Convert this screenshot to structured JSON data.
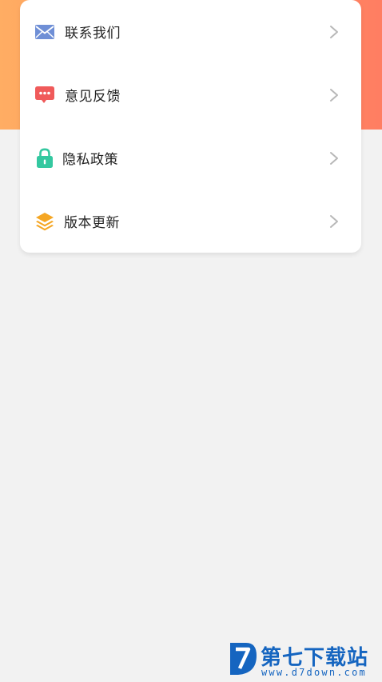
{
  "colors": {
    "header_gradient_start": "#ffad63",
    "header_gradient_end": "#ff7e62",
    "background": "#f2f2f2",
    "card": "#ffffff",
    "mail_icon": "#6f8fd6",
    "feedback_icon": "#f05a5a",
    "lock_icon": "#34c8a0",
    "layers_icon": "#f5a623",
    "chevron": "#b8b8b8",
    "watermark": "#1565c0"
  },
  "menu": {
    "items": [
      {
        "label": "联系我们",
        "icon": "mail-icon"
      },
      {
        "label": "意见反馈",
        "icon": "feedback-icon"
      },
      {
        "label": "隐私政策",
        "icon": "lock-icon"
      },
      {
        "label": "版本更新",
        "icon": "layers-icon"
      }
    ]
  },
  "watermark": {
    "title": "第七下载站",
    "url": "www.d7down.com"
  }
}
